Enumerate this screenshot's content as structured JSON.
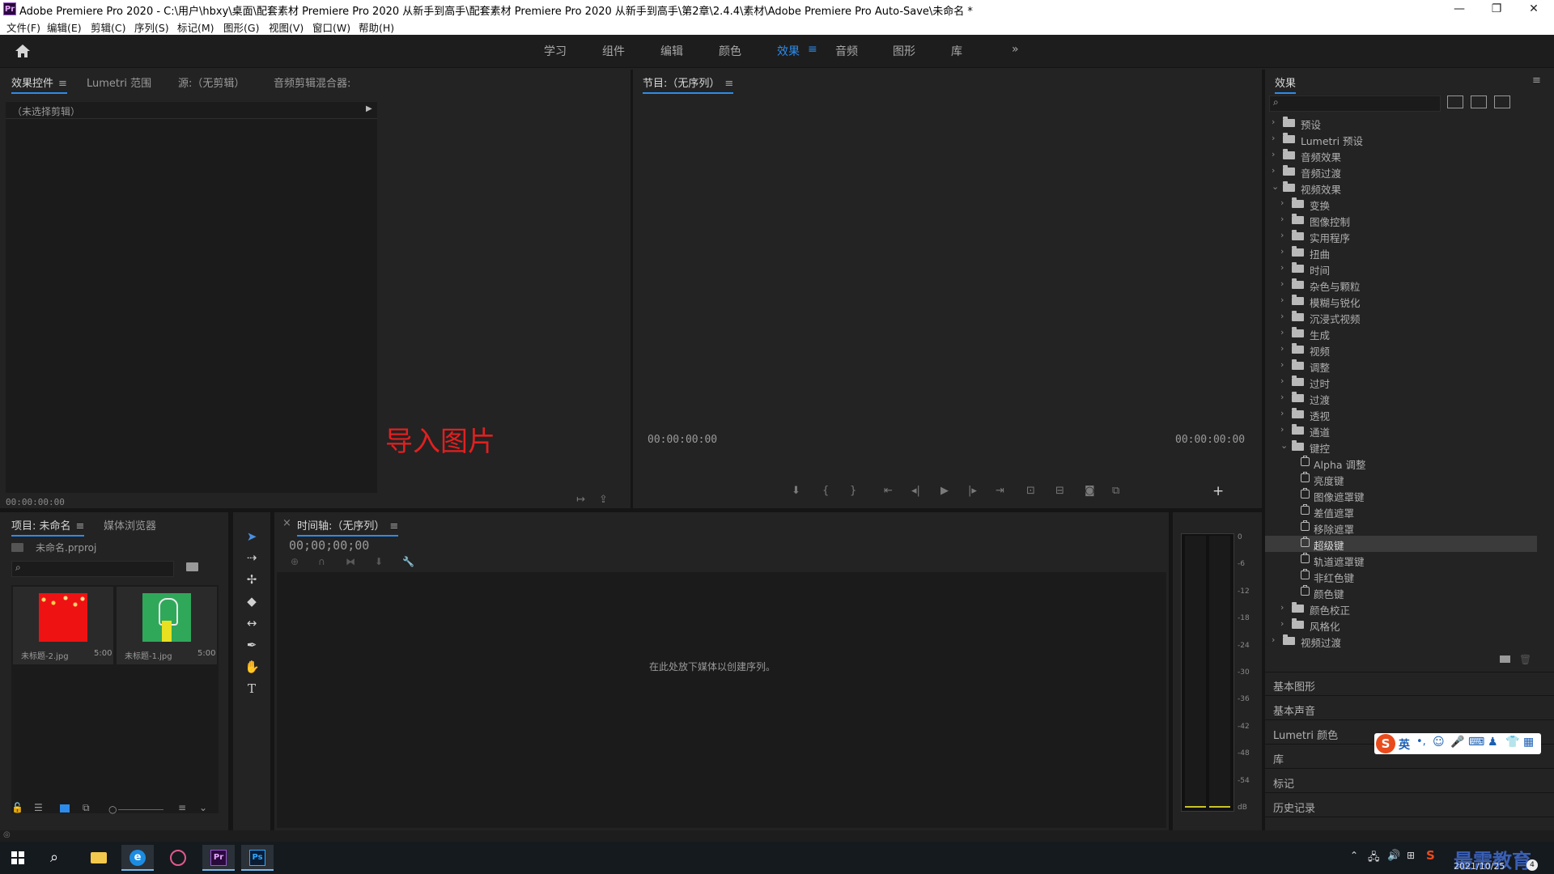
{
  "window": {
    "app_logo": "Pr",
    "title": "Adobe Premiere Pro 2020 - C:\\用户\\hbxy\\桌面\\配套素材 Premiere Pro 2020 从新手到高手\\配套素材 Premiere Pro 2020 从新手到高手\\第2章\\2.4.4\\素材\\Adobe Premiere Pro Auto-Save\\未命名 *",
    "minimize": "—",
    "restore": "❐",
    "close": "✕"
  },
  "menubar": [
    "文件(F)",
    "编辑(E)",
    "剪辑(C)",
    "序列(S)",
    "标记(M)",
    "图形(G)",
    "视图(V)",
    "窗口(W)",
    "帮助(H)"
  ],
  "workspaces": {
    "tabs": [
      "学习",
      "组件",
      "编辑",
      "颜色",
      "效果",
      "音频",
      "图形",
      "库"
    ],
    "active": "效果",
    "menu_glyph": "≡",
    "overflow": "»"
  },
  "source_panel": {
    "tabs": [
      "效果控件",
      "Lumetri 范围",
      "源:（无剪辑）",
      "音频剪辑混合器:"
    ],
    "active_tab": "效果控件",
    "no_clip": "（未选择剪辑）",
    "timecode": "00:00:00:00"
  },
  "annotation": {
    "text": "导入图片",
    "color": "#e02020"
  },
  "program_panel": {
    "tab": "节目:（无序列）",
    "timecode_left": "00:00:00:00",
    "timecode_right": "00:00:00:00"
  },
  "project_panel": {
    "tabs": [
      "项目: 未命名",
      "媒体浏览器"
    ],
    "project_file": "未命名.prproj",
    "items": [
      {
        "name": "未标题-2.jpg",
        "duration": "5:00"
      },
      {
        "name": "未标题-1.jpg",
        "duration": "5:00"
      }
    ]
  },
  "timeline_panel": {
    "close": "×",
    "tab": "时间轴:（无序列）",
    "timecode": "00;00;00;00",
    "empty_message": "在此处放下媒体以创建序列。"
  },
  "audio_meter": {
    "labels": [
      "0",
      "-6",
      "-12",
      "-18",
      "-24",
      "-30",
      "-36",
      "-42",
      "-48",
      "-54",
      "dB"
    ]
  },
  "effects_panel": {
    "title": "效果",
    "tree": [
      {
        "label": "预设",
        "level": 0,
        "kind": "folder-special",
        "open": false
      },
      {
        "label": "Lumetri 预设",
        "level": 0,
        "kind": "folder-special",
        "open": false
      },
      {
        "label": "音频效果",
        "level": 0,
        "kind": "folder",
        "open": false
      },
      {
        "label": "音频过渡",
        "level": 0,
        "kind": "folder",
        "open": false
      },
      {
        "label": "视频效果",
        "level": 0,
        "kind": "folder",
        "open": true
      },
      {
        "label": "变换",
        "level": 1,
        "kind": "folder",
        "open": false
      },
      {
        "label": "图像控制",
        "level": 1,
        "kind": "folder",
        "open": false
      },
      {
        "label": "实用程序",
        "level": 1,
        "kind": "folder",
        "open": false
      },
      {
        "label": "扭曲",
        "level": 1,
        "kind": "folder",
        "open": false
      },
      {
        "label": "时间",
        "level": 1,
        "kind": "folder",
        "open": false
      },
      {
        "label": "杂色与颗粒",
        "level": 1,
        "kind": "folder",
        "open": false
      },
      {
        "label": "模糊与锐化",
        "level": 1,
        "kind": "folder",
        "open": false
      },
      {
        "label": "沉浸式视频",
        "level": 1,
        "kind": "folder",
        "open": false
      },
      {
        "label": "生成",
        "level": 1,
        "kind": "folder",
        "open": false
      },
      {
        "label": "视频",
        "level": 1,
        "kind": "folder",
        "open": false
      },
      {
        "label": "调整",
        "level": 1,
        "kind": "folder",
        "open": false
      },
      {
        "label": "过时",
        "level": 1,
        "kind": "folder",
        "open": false
      },
      {
        "label": "过渡",
        "level": 1,
        "kind": "folder",
        "open": false
      },
      {
        "label": "透视",
        "level": 1,
        "kind": "folder",
        "open": false
      },
      {
        "label": "通道",
        "level": 1,
        "kind": "folder",
        "open": false
      },
      {
        "label": "键控",
        "level": 1,
        "kind": "folder",
        "open": true
      },
      {
        "label": "Alpha 调整",
        "level": 2,
        "kind": "effect"
      },
      {
        "label": "亮度键",
        "level": 2,
        "kind": "effect"
      },
      {
        "label": "图像遮罩键",
        "level": 2,
        "kind": "effect"
      },
      {
        "label": "差值遮罩",
        "level": 2,
        "kind": "effect"
      },
      {
        "label": "移除遮罩",
        "level": 2,
        "kind": "effect"
      },
      {
        "label": "超级键",
        "level": 2,
        "kind": "effect",
        "selected": true
      },
      {
        "label": "轨道遮罩键",
        "level": 2,
        "kind": "effect"
      },
      {
        "label": "非红色键",
        "level": 2,
        "kind": "effect"
      },
      {
        "label": "颜色键",
        "level": 2,
        "kind": "effect"
      },
      {
        "label": "颜色校正",
        "level": 1,
        "kind": "folder",
        "open": false
      },
      {
        "label": "风格化",
        "level": 1,
        "kind": "folder",
        "open": false
      },
      {
        "label": "视频过渡",
        "level": 0,
        "kind": "folder",
        "open": false
      }
    ],
    "bottom_sections": [
      "基本图形",
      "基本声音",
      "Lumetri 颜色",
      "库",
      "标记",
      "历史记录"
    ]
  },
  "ime_toolbar": {
    "lang": "英"
  },
  "taskbar": {
    "date": "2021/10/25",
    "watermark": "最需教育",
    "badge": "4"
  }
}
